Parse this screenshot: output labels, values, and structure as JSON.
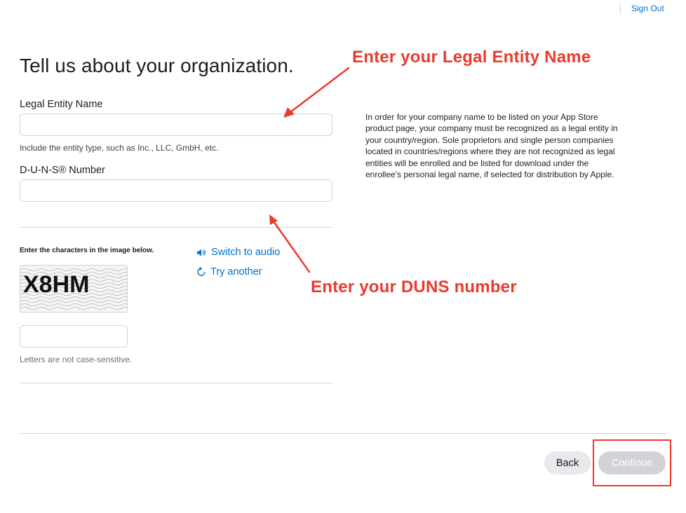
{
  "header": {
    "sign_out_label": "Sign Out"
  },
  "form": {
    "title": "Tell us about your organization.",
    "legal_entity": {
      "label": "Legal Entity Name",
      "value": "",
      "hint": "Include the entity type, such as Inc., LLC, GmbH, etc."
    },
    "duns": {
      "label": "D-U-N-S® Number",
      "value": ""
    },
    "info_text": "In order for your company name to be listed on your App Store product page, your company must be recognized as a legal entity in your country/region. Sole proprietors and single person companies located in countries/regions where they are not recognized as legal entities will be enrolled and be listed for download under the enrollee's personal legal name, if selected for distribution by Apple.",
    "captcha": {
      "prompt": "Enter the characters in the image below.",
      "image_text": "X8HM",
      "switch_audio_label": "Switch to audio",
      "switch_audio_icon": "speaker-icon",
      "try_another_label": "Try another",
      "try_another_icon": "refresh-icon",
      "value": "",
      "hint": "Letters are not case-sensitive."
    }
  },
  "footer": {
    "back_label": "Back",
    "continue_label": "Continue",
    "continue_enabled": false
  },
  "annotations": {
    "legal_entity_callout": "Enter your Legal Entity Name",
    "duns_callout": "Enter your DUNS number",
    "color": "#ea3a2d"
  },
  "colors": {
    "link": "#0070c9",
    "text": "#1d1d1f",
    "border": "#d2d2d7",
    "annotation": "#ea3a2d"
  }
}
